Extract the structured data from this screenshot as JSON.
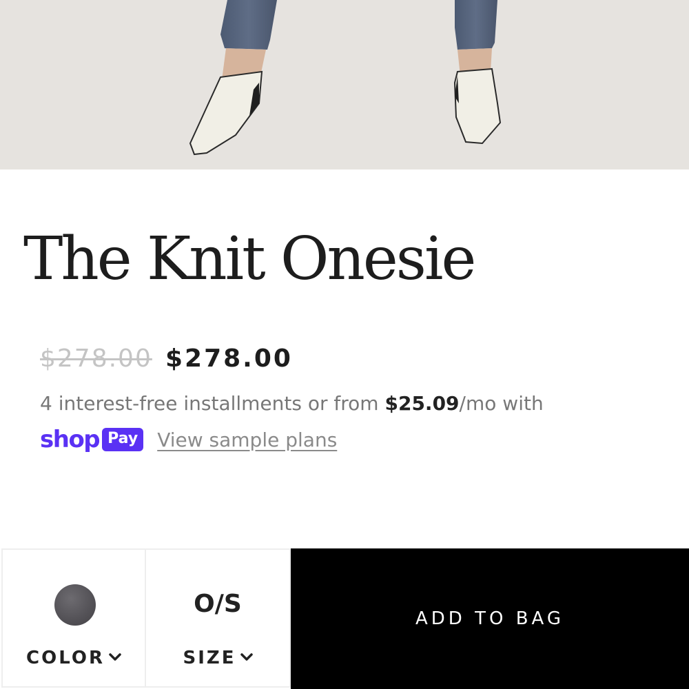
{
  "product": {
    "title": "The Knit Onesie",
    "price_original": "$278.00",
    "price_sale": "$278.00"
  },
  "installments": {
    "text_before": "4 interest-free installments or from ",
    "amount": "$25.09",
    "text_after": "/mo with"
  },
  "shop_pay": {
    "shop_word": "shop",
    "pay_word": "Pay",
    "link_label": "View sample plans",
    "brand_color": "#5a31f4"
  },
  "action_bar": {
    "color_label": "COLOR",
    "size_value": "O/S",
    "size_label": "SIZE",
    "add_to_bag_label": "ADD TO BAG",
    "swatch_color": "#555358"
  }
}
